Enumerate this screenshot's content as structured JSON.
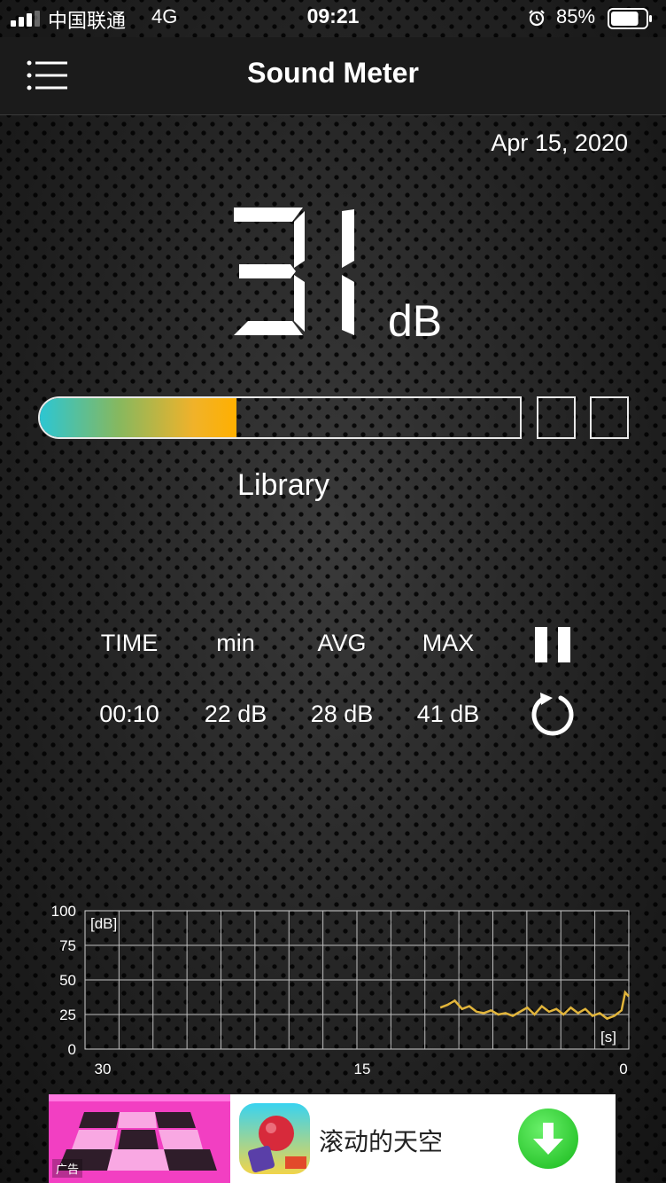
{
  "status_bar": {
    "carrier": "中国联通",
    "network": "4G",
    "time": "09:21",
    "battery": "85%",
    "battery_level": 0.85,
    "icons": [
      "signal-icon",
      "alarm-icon",
      "battery-icon"
    ]
  },
  "nav": {
    "title": "Sound Meter",
    "menu_icon": "menu-icon"
  },
  "meter": {
    "date": "Apr 15, 2020",
    "level": "31",
    "unit": "dB",
    "level_fraction": 0.41,
    "environment": "Library",
    "gradient_colors": [
      "#2cc6d3",
      "#86b85f",
      "#ffb000"
    ]
  },
  "stats": {
    "labels": {
      "time": "TIME",
      "min": "min",
      "avg": "AVG",
      "max": "MAX"
    },
    "values": {
      "time": "00:10",
      "min": "22 dB",
      "avg": "28 dB",
      "max": "41 dB"
    },
    "pause_icon": "pause-icon",
    "reset_icon": "reset-icon"
  },
  "graph": {
    "ylabel": "[dB]",
    "xlabel": "[s]",
    "y_ticks": [
      "100",
      "75",
      "50",
      "25",
      "0"
    ],
    "x_ticks": [
      "30",
      "15",
      "0"
    ],
    "line_color": "#e2b53b"
  },
  "chart_data": {
    "type": "line",
    "xlabel": "[s]",
    "ylabel": "[dB]",
    "xlim": [
      30,
      0
    ],
    "ylim": [
      0,
      100
    ],
    "grid": true,
    "series": [
      {
        "x": [
          10.4,
          10.0,
          9.6,
          9.2,
          8.8,
          8.4,
          8.0,
          7.6,
          7.2,
          6.8,
          6.4,
          6.0,
          5.6,
          5.2,
          4.8,
          4.4,
          4.0,
          3.6,
          3.2,
          2.8,
          2.4,
          2.0,
          1.6,
          1.2,
          0.8,
          0.4,
          0.2,
          0.0
        ],
        "y": [
          30,
          32,
          35,
          29,
          31,
          27,
          26,
          28,
          25,
          26,
          24,
          27,
          30,
          25,
          31,
          27,
          29,
          25,
          30,
          26,
          29,
          24,
          26,
          22,
          24,
          28,
          41,
          38
        ]
      }
    ]
  },
  "ad": {
    "tag": "广告",
    "title": "滚动的天空",
    "download_icon": "download-icon"
  }
}
